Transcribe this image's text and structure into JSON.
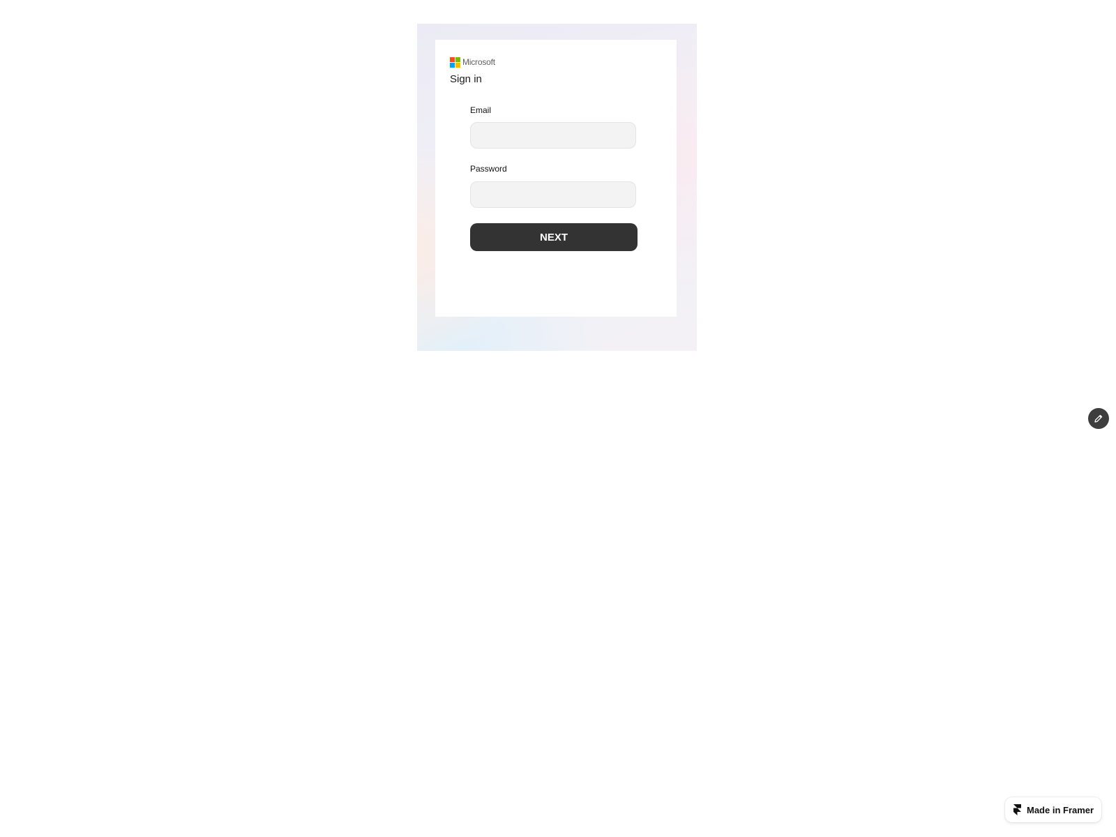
{
  "brand": {
    "name": "Microsoft",
    "logo_colors": [
      "#f25022",
      "#7fba00",
      "#00a4ef",
      "#ffb900"
    ]
  },
  "signin": {
    "title": "Sign in",
    "email_label": "Email",
    "email_value": "",
    "email_placeholder": "",
    "password_label": "Password",
    "password_value": "",
    "password_placeholder": "",
    "next_label": "NEXT"
  },
  "edit_button": {
    "icon": "pencil-icon"
  },
  "framer_badge": {
    "label": "Made in Framer",
    "icon": "framer-logo-icon"
  },
  "colors": {
    "button_bg": "#333333",
    "input_bg": "#f3f3f3",
    "fab_bg": "#3d3d3d"
  }
}
